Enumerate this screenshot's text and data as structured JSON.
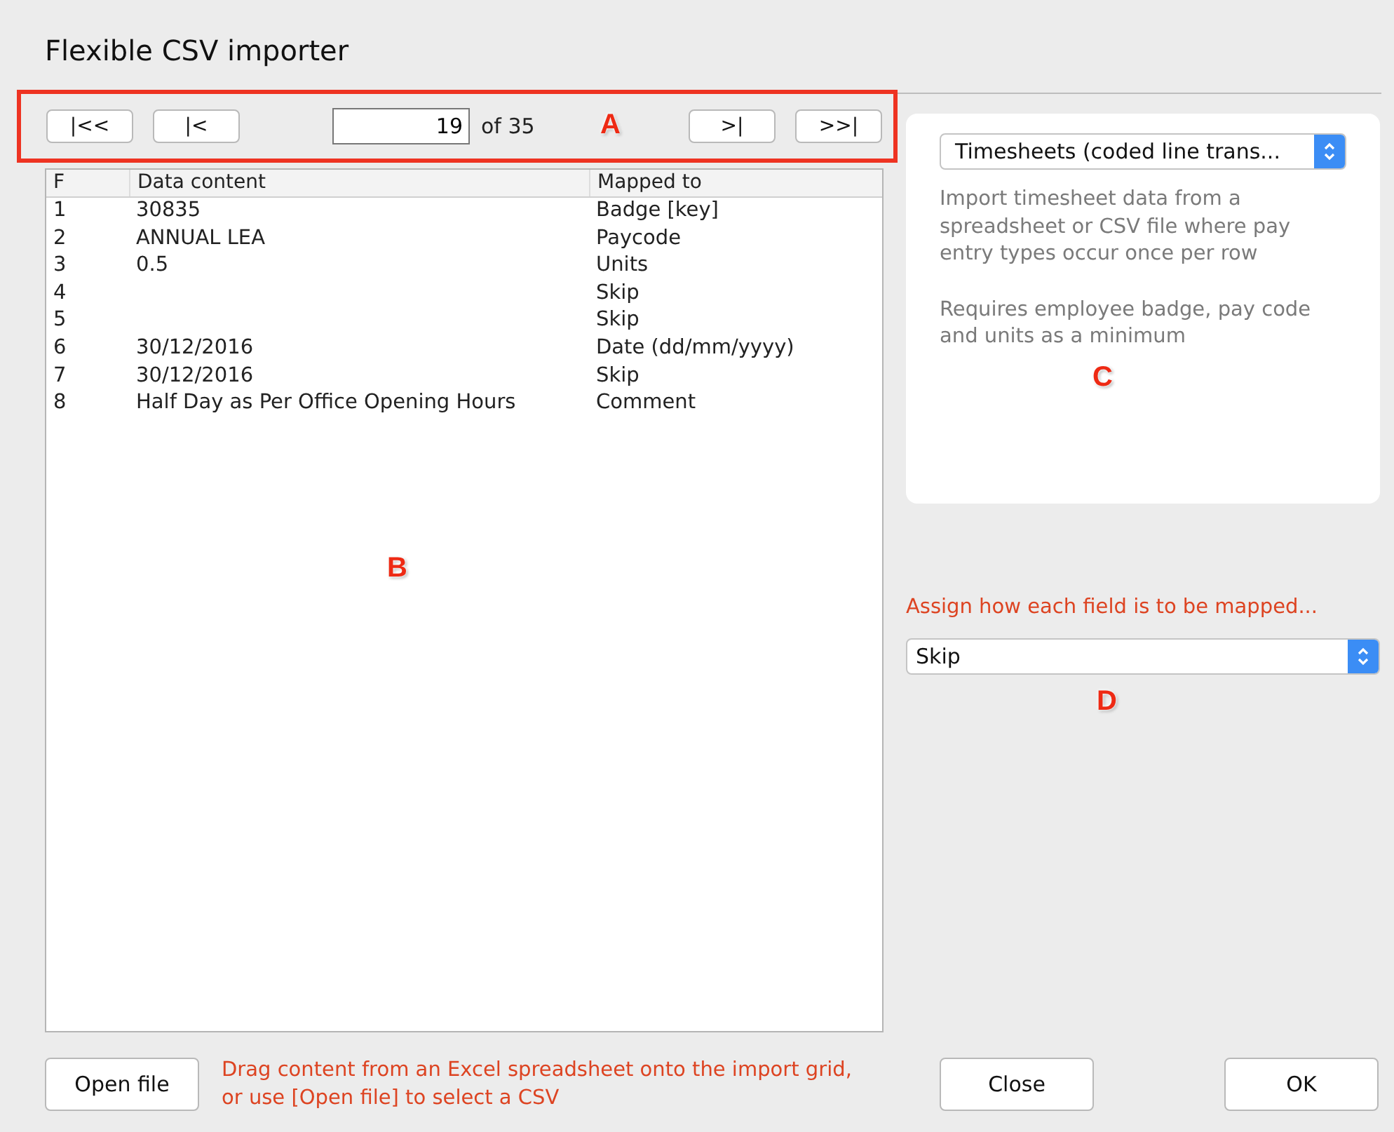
{
  "window": {
    "title": "Flexible CSV importer"
  },
  "pager": {
    "buttons": [
      "|<<",
      "|<",
      ">|",
      ">>|"
    ],
    "page": "19",
    "total": "of 35"
  },
  "table": {
    "columns": [
      "F",
      "Data content",
      "Mapped to"
    ],
    "rows": [
      {
        "f": "1",
        "data": "30835",
        "mapped": "Badge [key]"
      },
      {
        "f": "2",
        "data": "ANNUAL LEA",
        "mapped": "Paycode"
      },
      {
        "f": "3",
        "data": "0.5",
        "mapped": "Units"
      },
      {
        "f": "4",
        "mapped": "Skip"
      },
      {
        "f": "5",
        "mapped": "Skip"
      },
      {
        "f": "6",
        "data": "30/12/2016",
        "mapped": "Date (dd/mm/yyyy)"
      },
      {
        "f": "7",
        "data": "30/12/2016",
        "mapped": "Skip"
      },
      {
        "f": "8",
        "data": "Half Day as Per Office Opening Hours",
        "mapped": "Comment"
      }
    ]
  },
  "importer": {
    "type": "Timesheets (coded line trans...",
    "description": [
      "Import timesheet data from a spreadsheet or CSV file where pay entry types occur once per row",
      "Requires employee badge, pay code and units as a minimum"
    ]
  },
  "mapping": {
    "label": "Assign how each field is to be mapped...",
    "value": "Skip"
  },
  "footer": {
    "open_button": "Open file",
    "hint": "Drag content from an Excel spreadsheet onto the import grid, or use [Open file] to select a CSV",
    "close_button": "Close",
    "ok_button": "OK"
  },
  "callouts": [
    {
      "label": "A"
    },
    {
      "label": "B"
    },
    {
      "label": "C"
    },
    {
      "label": "D"
    }
  ]
}
